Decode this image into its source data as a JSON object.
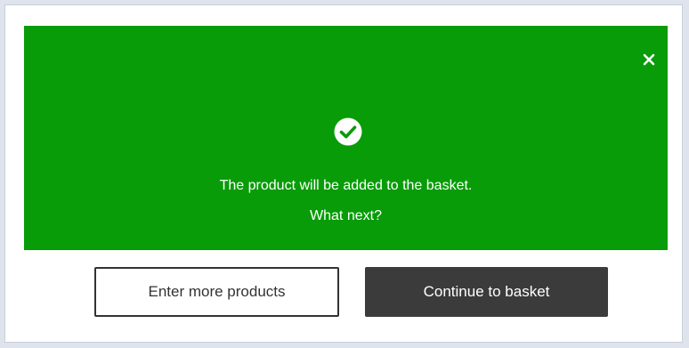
{
  "dialog": {
    "message_line1": "The product will be added to the basket.",
    "message_line2": "What next?",
    "success_icon": "check-circle-icon",
    "close_icon": "close-icon",
    "background_color": "#089c08"
  },
  "actions": {
    "enter_more_label": "Enter more products",
    "continue_label": "Continue to basket"
  }
}
